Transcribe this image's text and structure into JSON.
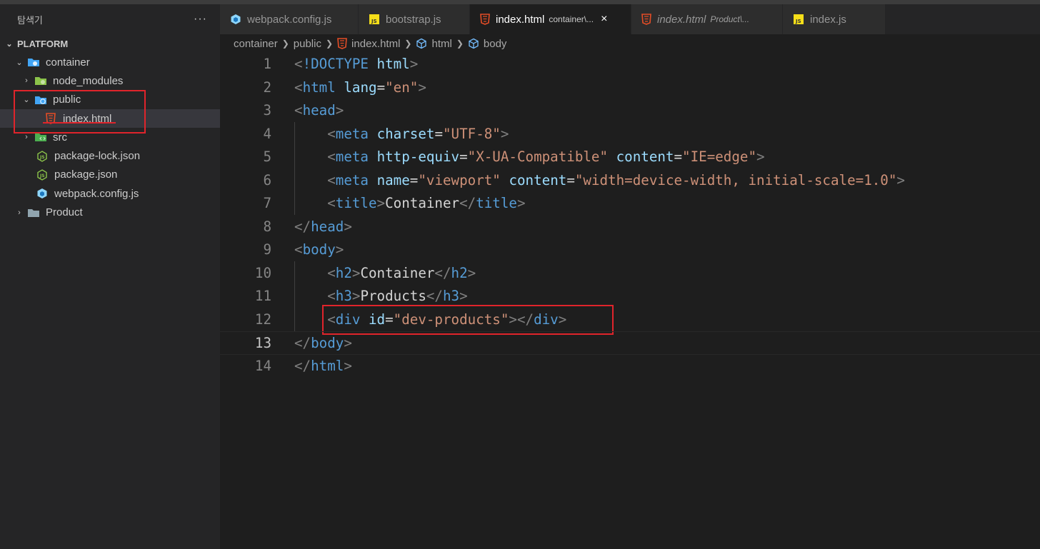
{
  "sidebar": {
    "title": "탐색기",
    "more": "···",
    "section": "PLATFORM",
    "items": [
      {
        "label": "container"
      },
      {
        "label": "node_modules"
      },
      {
        "label": "public"
      },
      {
        "label": "index.html"
      },
      {
        "label": "src"
      },
      {
        "label": "package-lock.json"
      },
      {
        "label": "package.json"
      },
      {
        "label": "webpack.config.js"
      },
      {
        "label": "Product"
      }
    ]
  },
  "tabs": [
    {
      "label": "webpack.config.js",
      "dir": ""
    },
    {
      "label": "bootstrap.js",
      "dir": ""
    },
    {
      "label": "index.html",
      "dir": "container\\..."
    },
    {
      "label": "index.html",
      "dir": "Product\\..."
    },
    {
      "label": "index.js",
      "dir": ""
    }
  ],
  "tab_close": "×",
  "breadcrumb": [
    "container",
    "public",
    "index.html",
    "html",
    "body"
  ],
  "editor": {
    "line_numbers": [
      "1",
      "2",
      "3",
      "4",
      "5",
      "6",
      "7",
      "8",
      "9",
      "10",
      "11",
      "12",
      "13",
      "14"
    ],
    "lines": [
      [
        [
          "t",
          "<"
        ],
        [
          "key",
          "!DOCTYPE"
        ],
        [
          "txt",
          " "
        ],
        [
          "attr",
          "html"
        ],
        [
          "t",
          ">"
        ]
      ],
      [
        [
          "t",
          "<"
        ],
        [
          "tag",
          "html"
        ],
        [
          "txt",
          " "
        ],
        [
          "attr",
          "lang"
        ],
        [
          "txt",
          "="
        ],
        [
          "str",
          "\"en\""
        ],
        [
          "t",
          ">"
        ]
      ],
      [
        [
          "t",
          "<"
        ],
        [
          "tag",
          "head"
        ],
        [
          "t",
          ">"
        ]
      ],
      [
        [
          "txt",
          "    "
        ],
        [
          "t",
          "<"
        ],
        [
          "tag",
          "meta"
        ],
        [
          "txt",
          " "
        ],
        [
          "attr",
          "charset"
        ],
        [
          "txt",
          "="
        ],
        [
          "str",
          "\"UTF-8\""
        ],
        [
          "t",
          ">"
        ]
      ],
      [
        [
          "txt",
          "    "
        ],
        [
          "t",
          "<"
        ],
        [
          "tag",
          "meta"
        ],
        [
          "txt",
          " "
        ],
        [
          "attr",
          "http-equiv"
        ],
        [
          "txt",
          "="
        ],
        [
          "str",
          "\"X-UA-Compatible\""
        ],
        [
          "txt",
          " "
        ],
        [
          "attr",
          "content"
        ],
        [
          "txt",
          "="
        ],
        [
          "str",
          "\"IE=edge\""
        ],
        [
          "t",
          ">"
        ]
      ],
      [
        [
          "txt",
          "    "
        ],
        [
          "t",
          "<"
        ],
        [
          "tag",
          "meta"
        ],
        [
          "txt",
          " "
        ],
        [
          "attr",
          "name"
        ],
        [
          "txt",
          "="
        ],
        [
          "str",
          "\"viewport\""
        ],
        [
          "txt",
          " "
        ],
        [
          "attr",
          "content"
        ],
        [
          "txt",
          "="
        ],
        [
          "str",
          "\"width=device-width, initial-scale=1.0\""
        ],
        [
          "t",
          ">"
        ]
      ],
      [
        [
          "txt",
          "    "
        ],
        [
          "t",
          "<"
        ],
        [
          "tag",
          "title"
        ],
        [
          "t",
          ">"
        ],
        [
          "txt",
          "Container"
        ],
        [
          "t",
          "</"
        ],
        [
          "tag",
          "title"
        ],
        [
          "t",
          ">"
        ]
      ],
      [
        [
          "t",
          "</"
        ],
        [
          "tag",
          "head"
        ],
        [
          "t",
          ">"
        ]
      ],
      [
        [
          "t",
          "<"
        ],
        [
          "tag",
          "body"
        ],
        [
          "t",
          ">"
        ]
      ],
      [
        [
          "txt",
          "    "
        ],
        [
          "t",
          "<"
        ],
        [
          "tag",
          "h2"
        ],
        [
          "t",
          ">"
        ],
        [
          "txt",
          "Container"
        ],
        [
          "t",
          "</"
        ],
        [
          "tag",
          "h2"
        ],
        [
          "t",
          ">"
        ]
      ],
      [
        [
          "txt",
          "    "
        ],
        [
          "t",
          "<"
        ],
        [
          "tag",
          "h3"
        ],
        [
          "t",
          ">"
        ],
        [
          "txt",
          "Products"
        ],
        [
          "t",
          "</"
        ],
        [
          "tag",
          "h3"
        ],
        [
          "t",
          ">"
        ]
      ],
      [
        [
          "txt",
          "    "
        ],
        [
          "t",
          "<"
        ],
        [
          "tag",
          "div"
        ],
        [
          "txt",
          " "
        ],
        [
          "attr",
          "id"
        ],
        [
          "txt",
          "="
        ],
        [
          "str",
          "\"dev-products\""
        ],
        [
          "t",
          "></"
        ],
        [
          "tag",
          "div"
        ],
        [
          "t",
          ">"
        ]
      ],
      [
        [
          "t",
          "</"
        ],
        [
          "tag",
          "body"
        ],
        [
          "t",
          ">"
        ]
      ],
      [
        [
          "t",
          "</"
        ],
        [
          "tag",
          "html"
        ],
        [
          "t",
          ">"
        ]
      ]
    ],
    "current_line": 13
  },
  "colors": {
    "highlight": "#e0242b",
    "tag": "#569cd6",
    "attribute": "#9cdcfe",
    "string": "#ce9178"
  }
}
